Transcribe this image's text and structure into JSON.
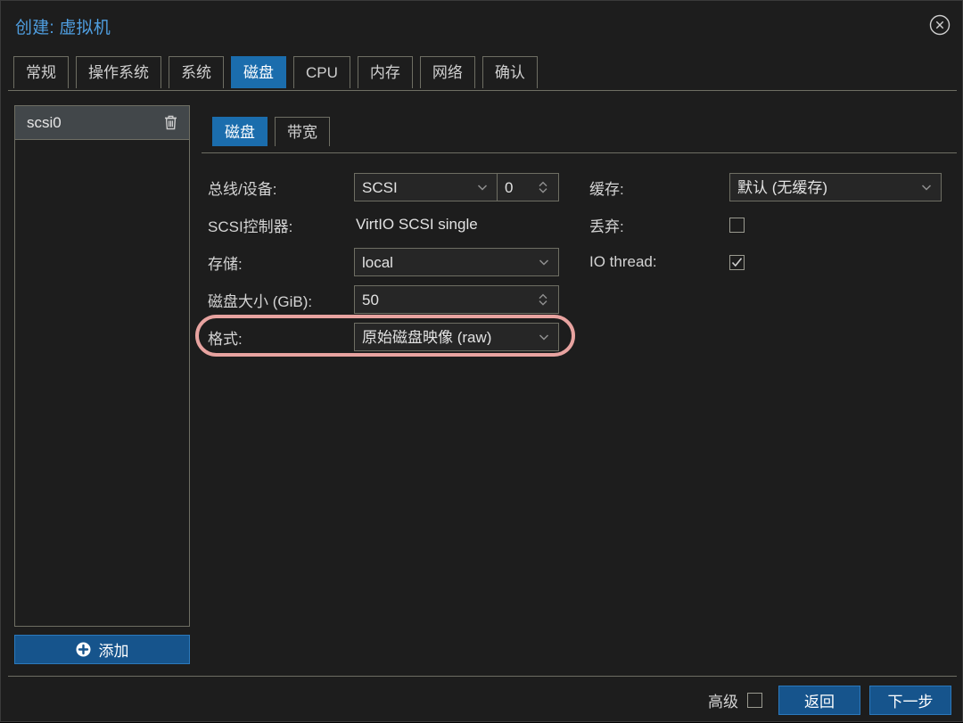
{
  "dialog": {
    "title": "创建: 虚拟机",
    "close_icon": "close-circle-icon"
  },
  "tabs": [
    {
      "label": "常规",
      "active": false
    },
    {
      "label": "操作系统",
      "active": false
    },
    {
      "label": "系统",
      "active": false
    },
    {
      "label": "磁盘",
      "active": true
    },
    {
      "label": "CPU",
      "active": false
    },
    {
      "label": "内存",
      "active": false
    },
    {
      "label": "网络",
      "active": false
    },
    {
      "label": "确认",
      "active": false
    }
  ],
  "disk_list": {
    "items": [
      {
        "name": "scsi0",
        "selected": true,
        "delete_icon": "trash-icon"
      }
    ],
    "add_button": {
      "label": "添加",
      "icon": "plus-circle-icon"
    }
  },
  "subtabs": [
    {
      "label": "磁盘",
      "active": true
    },
    {
      "label": "带宽",
      "active": false
    }
  ],
  "form": {
    "left": {
      "bus_device": {
        "label": "总线/设备:",
        "bus_value": "SCSI",
        "device_value": "0"
      },
      "scsi_controller": {
        "label": "SCSI控制器:",
        "value": "VirtIO SCSI single"
      },
      "storage": {
        "label": "存储:",
        "value": "local"
      },
      "disk_size": {
        "label": "磁盘大小 (GiB):",
        "value": "50"
      },
      "format": {
        "label": "格式:",
        "value": "原始磁盘映像 (raw)",
        "highlighted": true,
        "highlight_color": "#e8a3a0"
      }
    },
    "right": {
      "cache": {
        "label": "缓存:",
        "value": "默认 (无缓存)"
      },
      "discard": {
        "label": "丢弃:",
        "checked": false
      },
      "io_thread": {
        "label": "IO thread:",
        "checked": true
      }
    }
  },
  "footer": {
    "advanced_label": "高级",
    "advanced_checked": false,
    "back_label": "返回",
    "next_label": "下一步"
  },
  "colors": {
    "accent_blue": "#1b6dad",
    "title_blue": "#4f9ee0",
    "button_blue": "#16548c",
    "border": "#6e6e63",
    "background": "#1d1d1d",
    "field_bg": "#262626",
    "selected_row": "#42474a",
    "highlight": "#e8a3a0"
  }
}
